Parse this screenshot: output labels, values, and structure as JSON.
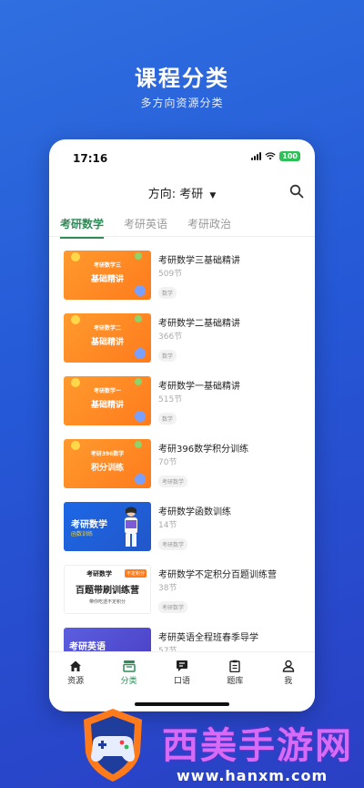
{
  "hero": {
    "title": "课程分类",
    "subtitle": "多方向资源分类"
  },
  "status_bar": {
    "time": "17:16",
    "battery": "100"
  },
  "header": {
    "direction_label": "方向:",
    "direction_value": "考研"
  },
  "tabs": [
    {
      "label": "考研数学",
      "active": true
    },
    {
      "label": "考研英语",
      "active": false
    },
    {
      "label": "考研政治",
      "active": false
    }
  ],
  "courses": [
    {
      "title": "考研数学三基础精讲",
      "count": "509节",
      "tag": "数学",
      "thumb": {
        "style": "orange",
        "small": "考研数学三",
        "big": "基础精讲"
      }
    },
    {
      "title": "考研数学二基础精讲",
      "count": "366节",
      "tag": "数学",
      "thumb": {
        "style": "orange",
        "small": "考研数学二",
        "big": "基础精讲"
      }
    },
    {
      "title": "考研数学一基础精讲",
      "count": "515节",
      "tag": "数学",
      "thumb": {
        "style": "orange",
        "small": "考研数学一",
        "big": "基础精讲"
      }
    },
    {
      "title": "考研396数学积分训练",
      "count": "70节",
      "tag": "考研数学",
      "thumb": {
        "style": "orange",
        "small": "考研396数学",
        "big": "积分训练"
      }
    },
    {
      "title": "考研数学函数训练",
      "count": "14节",
      "tag": "考研数学",
      "thumb": {
        "style": "blue",
        "line1": "考研数学",
        "line2": "函数训练"
      }
    },
    {
      "title": "考研数学不定积分百题训练营",
      "count": "38节",
      "tag": "考研数学",
      "thumb": {
        "style": "white",
        "line1": "考研数学",
        "badge": "不定积分",
        "line2": "百题带刷训练营",
        "line3": "带你吃透不定积分"
      }
    },
    {
      "title": "考研英语全程班春季导学",
      "count": "57节",
      "tag": "",
      "thumb": {
        "style": "purple",
        "line1": "考研英语"
      }
    }
  ],
  "tabbar": [
    {
      "label": "资源",
      "icon": "home-icon",
      "active": false
    },
    {
      "label": "分类",
      "icon": "category-icon",
      "active": true
    },
    {
      "label": "口语",
      "icon": "chat-icon",
      "active": false
    },
    {
      "label": "题库",
      "icon": "clipboard-icon",
      "active": false
    },
    {
      "label": "我",
      "icon": "user-icon",
      "active": false
    }
  ],
  "watermark": {
    "text": "西美手游网",
    "url": "www.hanxm.com"
  },
  "colors": {
    "accent": "#2e8b57",
    "background": "#2558d6",
    "thumb_orange": "#ff8a24"
  }
}
